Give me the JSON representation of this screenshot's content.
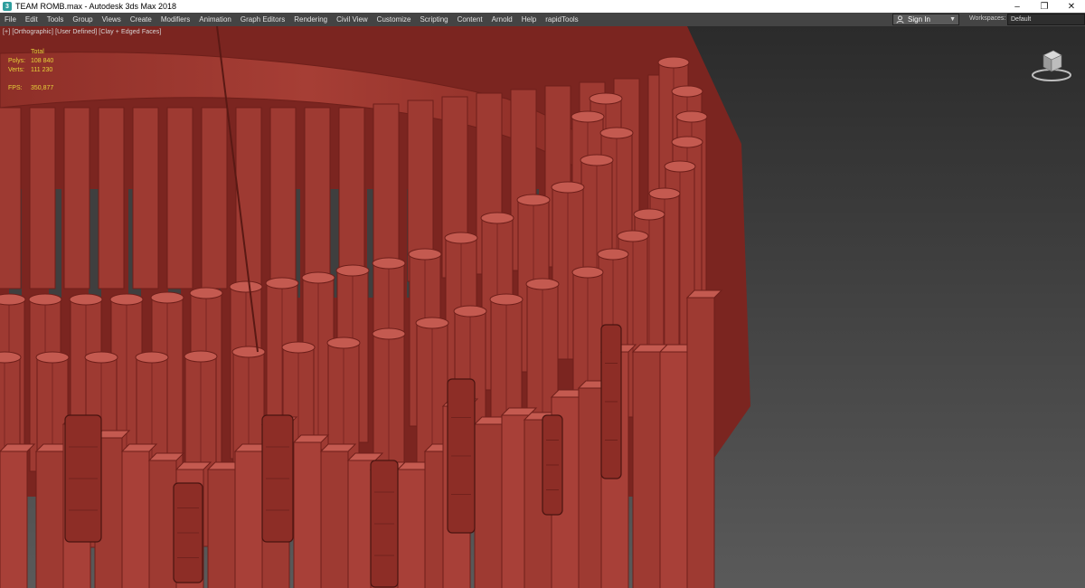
{
  "window": {
    "title": "TEAM ROMB.max - Autodesk 3ds Max 2018",
    "minimize": "–",
    "maximize": "❐",
    "close": "✕"
  },
  "menu": [
    "File",
    "Edit",
    "Tools",
    "Group",
    "Views",
    "Create",
    "Modifiers",
    "Animation",
    "Graph Editors",
    "Rendering",
    "Civil View",
    "Customize",
    "Scripting",
    "Content",
    "Arnold",
    "Help",
    "rapidTools"
  ],
  "account": {
    "signin_label": "Sign In"
  },
  "workspaces": {
    "label": "Workspaces:",
    "value": "Default"
  },
  "viewport": {
    "label": "[+] [Orthographic] [User Defined] [Clay + Edged Faces]",
    "stats": {
      "header": "Total",
      "polys_label": "Polys:",
      "polys_value": "108 840",
      "verts_label": "Verts:",
      "verts_value": "111 230",
      "fps_label": "FPS:",
      "fps_value": "350,877"
    }
  },
  "colors": {
    "model": "#9e3a32",
    "model_dark": "#6e1f1a",
    "model_light": "#c45a50",
    "background": "#444444",
    "stats_text": "#e6d23a"
  },
  "icons": [
    "app-icon",
    "user-icon",
    "viewcube-icon"
  ]
}
